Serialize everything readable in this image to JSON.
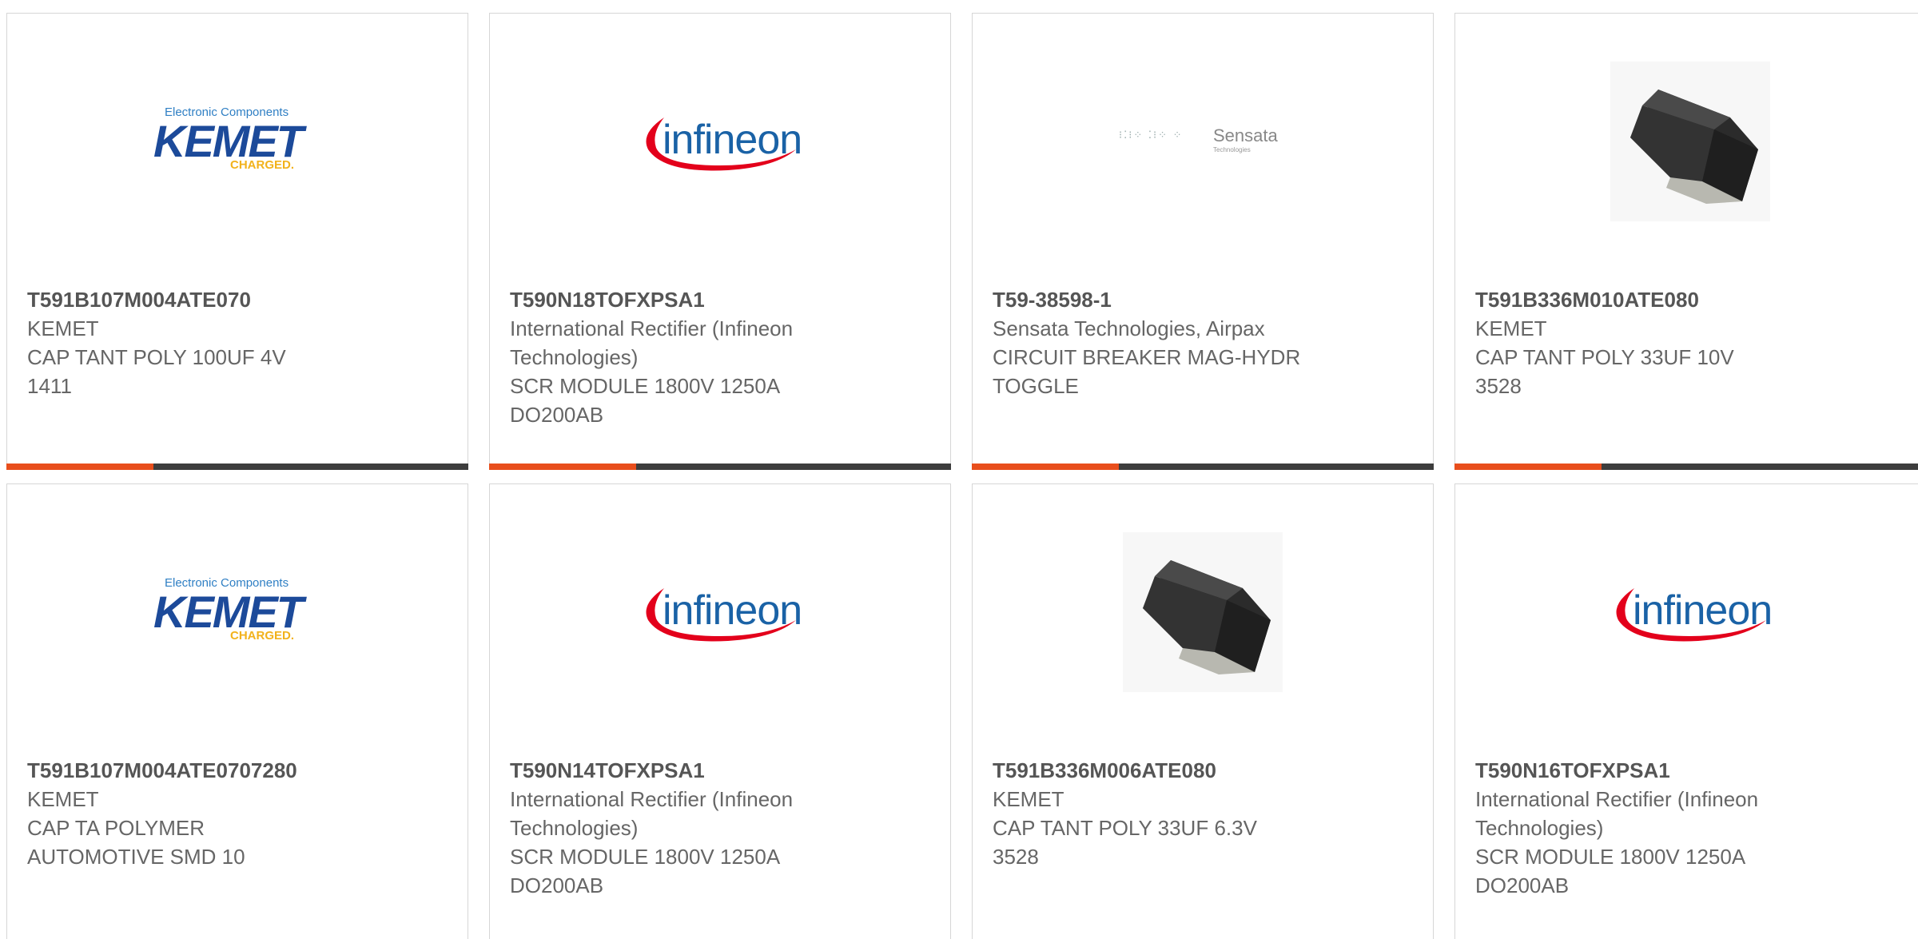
{
  "products": [
    {
      "part_number": "T591B107M004ATE070",
      "manufacturer": "KEMET",
      "description": [
        "CAP TANT POLY 100UF 4V",
        "1411"
      ],
      "image": "kemet-logo"
    },
    {
      "part_number": "T590N18TOFXPSA1",
      "manufacturer": "International Rectifier (Infineon Technologies)",
      "description": [
        "SCR MODULE 1800V 1250A",
        "DO200AB"
      ],
      "image": "infineon-logo"
    },
    {
      "part_number": "T59-38598-1",
      "manufacturer": "Sensata Technologies, Airpax",
      "description": [
        "CIRCUIT BREAKER MAG-HYDR",
        "TOGGLE"
      ],
      "image": "sensata-logo"
    },
    {
      "part_number": "T591B336M010ATE080",
      "manufacturer": "KEMET",
      "description": [
        "CAP TANT POLY 33UF 10V",
        "3528"
      ],
      "image": "chip-photo"
    },
    {
      "part_number": "T591B107M004ATE0707280",
      "manufacturer": "KEMET",
      "description": [
        "CAP TA POLYMER",
        "AUTOMOTIVE SMD 10"
      ],
      "image": "kemet-logo"
    },
    {
      "part_number": "T590N14TOFXPSA1",
      "manufacturer": "International Rectifier (Infineon Technologies)",
      "description": [
        "SCR MODULE 1800V 1250A",
        "DO200AB"
      ],
      "image": "infineon-logo"
    },
    {
      "part_number": "T591B336M006ATE080",
      "manufacturer": "KEMET",
      "description": [
        "CAP TANT POLY 33UF 6.3V",
        "3528"
      ],
      "image": "chip-photo"
    },
    {
      "part_number": "T590N16TOFXPSA1",
      "manufacturer": "International Rectifier (Infineon Technologies)",
      "description": [
        "SCR MODULE 1800V 1250A",
        "DO200AB"
      ],
      "image": "infineon-logo"
    }
  ],
  "logos": {
    "kemet": {
      "top": "Electronic Components",
      "main": "KEMET",
      "bottom": "CHARGED."
    },
    "infineon": {
      "main": "infineon"
    },
    "sensata": {
      "main": "Sensata",
      "sub": "Technologies"
    }
  },
  "colors": {
    "accent": "#e84e1c",
    "bar": "#3d3d3d",
    "text": "#666666"
  }
}
